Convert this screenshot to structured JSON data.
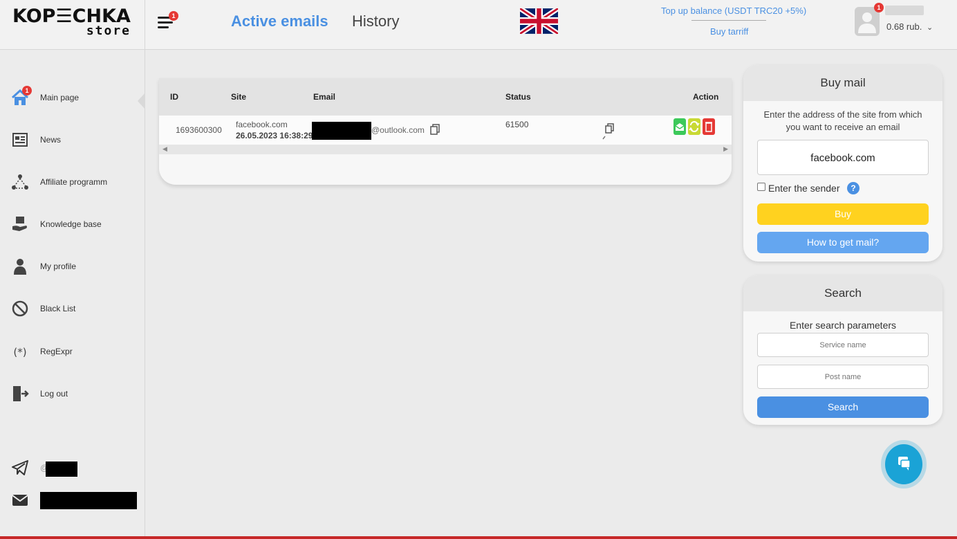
{
  "header": {
    "logo_top": "KOP☰CHKA",
    "logo_bottom": "store",
    "menu_badge": "1",
    "tabs": [
      {
        "label": "Active emails"
      },
      {
        "label": "History"
      }
    ],
    "top_up_label": "Top up balance (USDT TRC20 +5%)",
    "buy_tariff_label": "Buy tarriff",
    "avatar_badge": "1",
    "balance": "0.68 rub."
  },
  "sidebar": {
    "items": [
      {
        "label": "Main page",
        "icon": "home-icon",
        "badge": "1"
      },
      {
        "label": "News",
        "icon": "news-icon"
      },
      {
        "label": "Affiliate programm",
        "icon": "affiliate-icon"
      },
      {
        "label": "Knowledge base",
        "icon": "knowledge-icon"
      },
      {
        "label": "My profile",
        "icon": "profile-icon"
      },
      {
        "label": "Black List",
        "icon": "blocked-icon"
      },
      {
        "label": "RegExpr",
        "icon": "regexp-icon"
      },
      {
        "label": "Log out",
        "icon": "logout-icon"
      }
    ],
    "telegram_prefix": "@"
  },
  "table": {
    "columns": [
      "ID",
      "Site",
      "Email",
      "Status",
      "Action"
    ],
    "rows": [
      {
        "id": "1693600300",
        "site": "facebook.com",
        "date": "26.05.2023 16:38:29",
        "email_suffix": "@outlook.com",
        "status": "61500"
      }
    ]
  },
  "buy_mail": {
    "title": "Buy mail",
    "instruction": "Enter the address of the site from which you want to receive an email",
    "site_value": "facebook.com",
    "sender_label": "Enter the sender",
    "buy_label": "Buy",
    "how_label": "How to get mail?"
  },
  "search": {
    "title": "Search",
    "instruction": "Enter search parameters",
    "service_placeholder": "Service name",
    "post_placeholder": "Post name",
    "search_label": "Search"
  },
  "colors": {
    "accent": "#4a90e2",
    "buy_yellow": "#ffd21f",
    "how_blue": "#64a6f0",
    "chat": "#1aa3d6"
  }
}
